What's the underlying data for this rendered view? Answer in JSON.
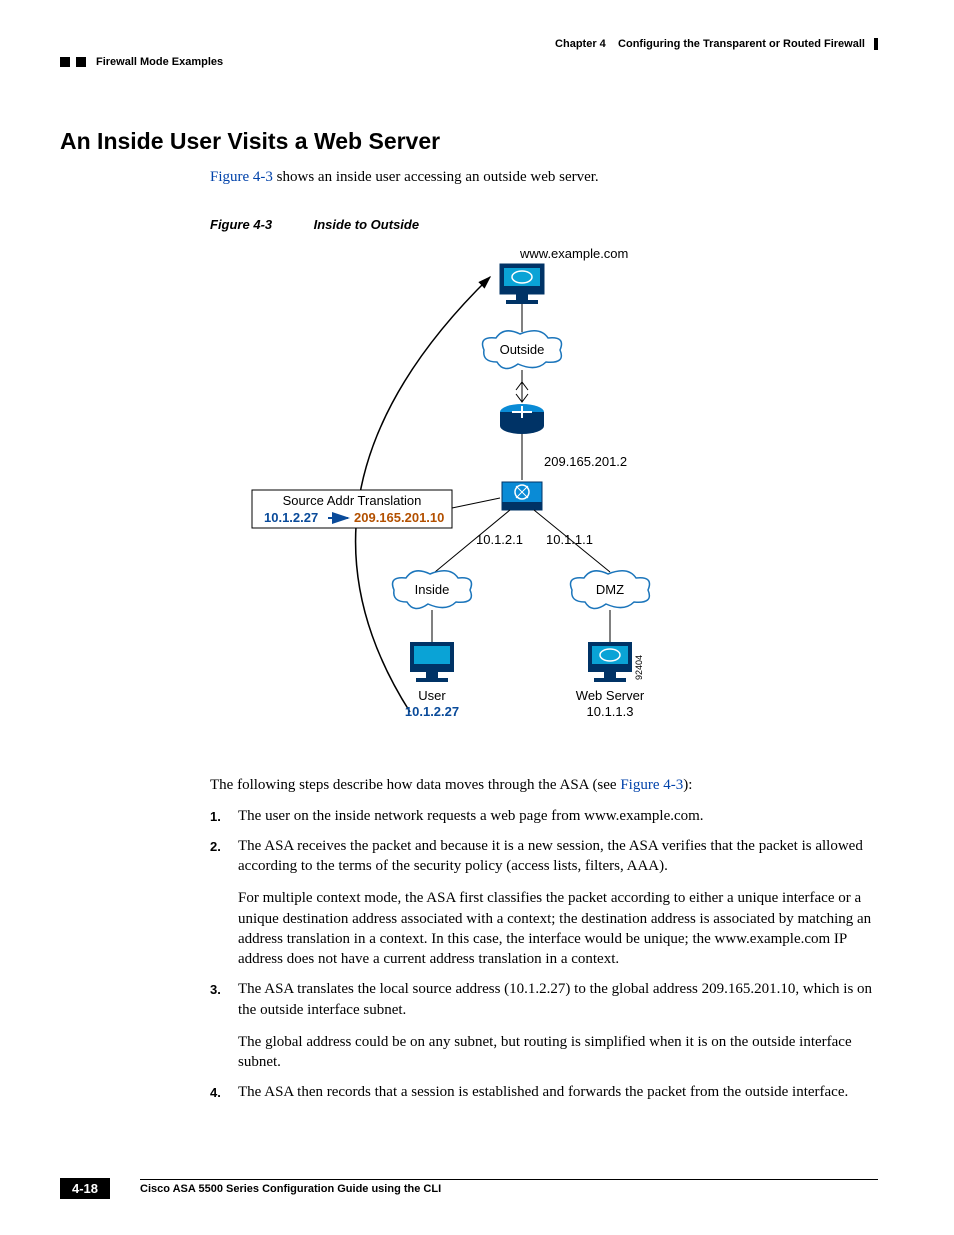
{
  "header": {
    "chapter_label": "Chapter 4",
    "chapter_title": "Configuring the Transparent or Routed Firewall",
    "section": "Firewall Mode Examples"
  },
  "heading": "An Inside User Visits a Web Server",
  "intro": {
    "fig_ref": "Figure 4-3",
    "rest": " shows an inside user accessing an outside web server."
  },
  "figure": {
    "number": "Figure 4-3",
    "title": "Inside to Outside",
    "labels": {
      "web_host": "www.example.com",
      "outside": "Outside",
      "asa_outside_ip": "209.165.201.2",
      "asa_inside_ip": "10.1.2.1",
      "asa_dmz_ip": "10.1.1.1",
      "inside": "Inside",
      "dmz": "DMZ",
      "user": "User",
      "user_ip": "10.1.2.27",
      "web_server": "Web Server",
      "web_server_ip": "10.1.1.3",
      "nat_box_title": "Source Addr Translation",
      "nat_src": "10.1.2.27",
      "nat_dst": "209.165.201.10",
      "diagram_id": "92404"
    }
  },
  "after_figure": {
    "pre": "The following steps describe how data moves through the ASA (see ",
    "fig_ref": "Figure 4-3",
    "post": "):"
  },
  "steps": [
    {
      "num": "1.",
      "paras": [
        "The user on the inside network requests a web page from www.example.com."
      ]
    },
    {
      "num": "2.",
      "paras": [
        "The ASA receives the packet and because it is a new session, the ASA verifies that the packet is allowed according to the terms of the security policy (access lists, filters, AAA).",
        "For multiple context mode, the ASA first classifies the packet according to either a unique interface or a unique destination address associated with a context; the destination address is associated by matching an address translation in a context. In this case, the interface would be unique; the www.example.com IP address does not have a current address translation in a context."
      ]
    },
    {
      "num": "3.",
      "paras": [
        "The ASA translates the local source address (10.1.2.27) to the global address 209.165.201.10, which is on the outside interface subnet.",
        "The global address could be on any subnet, but routing is simplified when it is on the outside interface subnet."
      ]
    },
    {
      "num": "4.",
      "paras": [
        "The ASA then records that a session is established and forwards the packet from the outside interface."
      ]
    }
  ],
  "footer": {
    "title": "Cisco ASA 5500 Series Configuration Guide using the CLI",
    "page": "4-18"
  }
}
